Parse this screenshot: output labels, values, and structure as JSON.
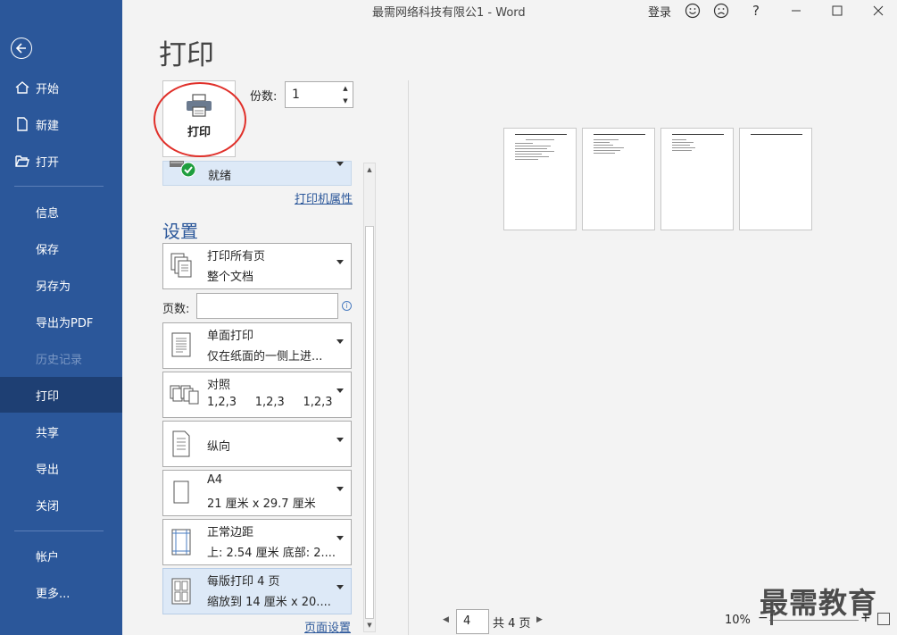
{
  "window": {
    "title": "最需网络科技有限公1  -  Word",
    "login_label": "登录",
    "icons": [
      "smile-icon",
      "frown-icon",
      "help-icon",
      "minimize-icon",
      "maximize-icon",
      "close-icon"
    ],
    "help_label": "?"
  },
  "sidebar": {
    "back_icon": "back-arrow-icon",
    "items": [
      {
        "label": "开始",
        "icon": "home-icon"
      },
      {
        "label": "新建",
        "icon": "new-document-icon"
      },
      {
        "label": "打开",
        "icon": "folder-open-icon"
      },
      {
        "label": "信息"
      },
      {
        "label": "保存"
      },
      {
        "label": "另存为"
      },
      {
        "label": "导出为PDF"
      },
      {
        "label": "历史记录",
        "state": "disabled"
      },
      {
        "label": "打印",
        "state": "active"
      },
      {
        "label": "共享"
      },
      {
        "label": "导出"
      },
      {
        "label": "关闭"
      },
      {
        "label": "帐户"
      },
      {
        "label": "更多..."
      }
    ]
  },
  "print": {
    "page_title": "打印",
    "print_button_label": "打印",
    "copies_label": "份数:",
    "copies_value": "1",
    "printer_status": "就绪",
    "printer_properties_link": "打印机属性",
    "settings_heading": "设置",
    "pages_label": "页数:",
    "pages_value": "",
    "page_setup_link": "页面设置",
    "settings": [
      {
        "line1": "打印所有页",
        "line2": "整个文档",
        "icon": "pages-icon"
      },
      {
        "line1": "单面打印",
        "line2": "仅在纸面的一侧上进...",
        "icon": "single-side-icon"
      },
      {
        "line1": "对照",
        "line2": "1,2,3     1,2,3     1,2,3",
        "icon": "collate-icon"
      },
      {
        "line1": "纵向",
        "line2": "",
        "icon": "portrait-icon"
      },
      {
        "line1": "A4",
        "line2": "21 厘米 x 29.7 厘米",
        "icon": "paper-size-icon"
      },
      {
        "line1": "正常边距",
        "line2": "上: 2.54 厘米 底部: 2....",
        "icon": "margins-icon"
      },
      {
        "line1": "每版打印 4 页",
        "line2": "缩放到 14 厘米 x 20....",
        "icon": "pages-per-sheet-icon",
        "highlighted": true
      }
    ]
  },
  "preview": {
    "page_count_shown": 4,
    "current_page": "4",
    "total_pages_label": "共 4 页",
    "zoom_label": "10%",
    "zoom_level": 0.1
  },
  "watermark": "最需教育",
  "colors": {
    "sidebar": "#2b579a",
    "sidebar_active": "#1e3f73",
    "highlight": "#dde9f7",
    "circle_annotation": "#e0302a",
    "ready_check": "#1f9e3f"
  }
}
